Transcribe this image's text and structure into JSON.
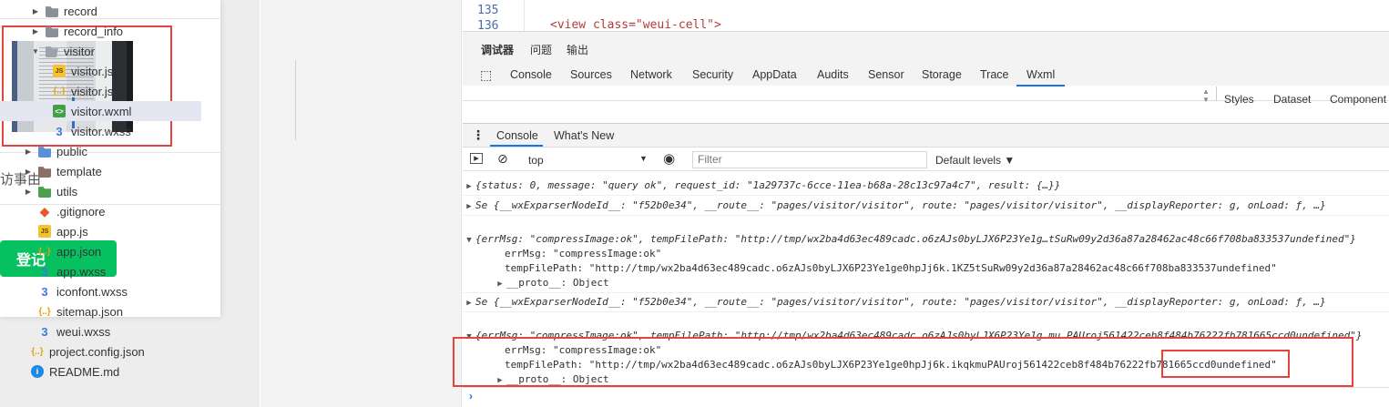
{
  "simulator": {
    "visit_reason_label": "访事由",
    "register_button": "登记"
  },
  "file_tree": {
    "items": [
      {
        "name": "record",
        "icon": "folder-icon"
      },
      {
        "name": "record_info",
        "icon": "folder-icon"
      },
      {
        "name": "visitor",
        "icon": "folder-open-icon"
      },
      {
        "name": "visitor.js",
        "icon": "js-file-icon"
      },
      {
        "name": "visitor.json",
        "icon": "json-file-icon"
      },
      {
        "name": "visitor.wxml",
        "icon": "wxml-file-icon"
      },
      {
        "name": "visitor.wxss",
        "icon": "wxss-file-icon"
      },
      {
        "name": "public",
        "icon": "folder-icon"
      },
      {
        "name": "template",
        "icon": "folder-icon"
      },
      {
        "name": "utils",
        "icon": "folder-icon"
      },
      {
        "name": ".gitignore",
        "icon": "git-icon"
      },
      {
        "name": "app.js",
        "icon": "js-file-icon"
      },
      {
        "name": "app.json",
        "icon": "json-file-icon"
      },
      {
        "name": "app.wxss",
        "icon": "wxss-file-icon"
      },
      {
        "name": "iconfont.wxss",
        "icon": "wxss-file-icon"
      },
      {
        "name": "sitemap.json",
        "icon": "json-file-icon"
      },
      {
        "name": "weui.wxss",
        "icon": "wxss-file-icon"
      },
      {
        "name": "project.config.json",
        "icon": "json-file-icon"
      },
      {
        "name": "README.md",
        "icon": "info-icon"
      }
    ]
  },
  "editor": {
    "line_numbers": [
      "135",
      "136"
    ],
    "code": "<view class=\"weui-cell\">"
  },
  "devtools": {
    "top_tabs": [
      "调试器",
      "问题",
      "输出"
    ],
    "sub_tabs": [
      "Console",
      "Sources",
      "Network",
      "Security",
      "AppData",
      "Audits",
      "Sensor",
      "Storage",
      "Trace",
      "Wxml"
    ],
    "active_sub_tab": "Wxml",
    "side_tabs": [
      "Styles",
      "Dataset",
      "Component"
    ],
    "console_tabs": [
      "Console",
      "What's New"
    ],
    "context": "top",
    "filter_placeholder": "Filter",
    "levels": "Default levels ▼"
  },
  "console": {
    "line1": "{status: 0, message: \"query ok\", request_id: \"1a29737c-6cce-11ea-b68a-28c13c97a4c7\", result: {…}}",
    "line2": "Se {__wxExparserNodeId__: \"f52b0e34\", __route__: \"pages/visitor/visitor\", route: \"pages/visitor/visitor\", __displayReporter: g, onLoad: ƒ, …}",
    "line3": "{errMsg: \"compressImage:ok\", tempFilePath: \"http://tmp/wx2ba4d63ec489cadc.o6zAJs0byLJX6P23Ye1g…tSuRw09y2d36a87a28462ac48c66f708ba833537undefined\"}",
    "line3_errmsg": "errMsg: \"compressImage:ok\"",
    "line3_path": "tempFilePath: \"http://tmp/wx2ba4d63ec489cadc.o6zAJs0byLJX6P23Ye1ge0hpJj6k.1KZ5tSuRw09y2d36a87a28462ac48c66f708ba833537undefined\"",
    "proto": "__proto__: Object",
    "line4": "Se {__wxExparserNodeId__: \"f52b0e34\", __route__: \"pages/visitor/visitor\", route: \"pages/visitor/visitor\", __displayReporter: g, onLoad: ƒ, …}",
    "line5": "{errMsg: \"compressImage:ok\", tempFilePath: \"http://tmp/wx2ba4d63ec489cadc.o6zAJs0byLJX6P23Ye1g…mu PAUroj561422ceb8f484b76222fb781665ccd0undefined\"}",
    "line5_errmsg": "errMsg: \"compressImage:ok\"",
    "line5_path": "tempFilePath: \"http://tmp/wx2ba4d63ec489cadc.o6zAJs0byLJX6P23Ye1ge0hpJj6k.ikqkmuPAUroj561422ceb8f484b76222fb781665ccd0undefined\""
  }
}
